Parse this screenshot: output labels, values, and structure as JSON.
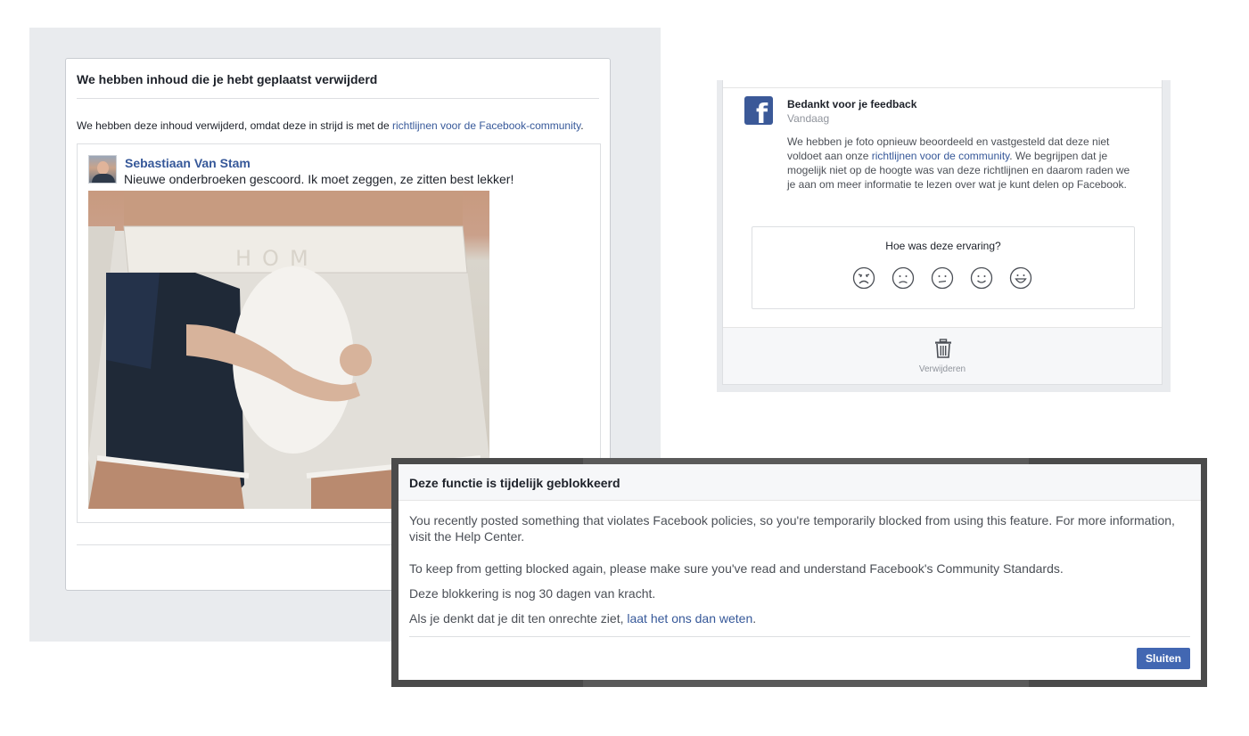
{
  "removed_panel": {
    "title": "We hebben inhoud die je hebt geplaatst verwijderd",
    "description_prefix": "We hebben deze inhoud verwijderd, omdat deze in strijd is met de ",
    "description_link": "richtlijnen voor de Facebook-community",
    "description_suffix": ".",
    "post": {
      "author": "Sebastiaan Van Stam",
      "text": "Nieuwe onderbroeken gescoord. Ik moet zeggen, ze zitten best lekker!",
      "image_brand_text": "HOM"
    }
  },
  "feedback_panel": {
    "title": "Bedankt voor je feedback",
    "time": "Vandaag",
    "body_prefix": "We hebben je foto opnieuw beoordeeld en vastgesteld dat deze niet voldoet aan onze ",
    "body_link": "richtlijnen voor de community",
    "body_suffix": ". We begrijpen dat je mogelijk niet op de hoogte was van deze richtlijnen en daarom raden we je aan om meer informatie te lezen over wat je kunt delen op Facebook.",
    "experience_question": "Hoe was deze ervaring?",
    "rating_options": [
      "very-sad-face-icon",
      "sad-face-icon",
      "neutral-face-icon",
      "smile-face-icon",
      "grin-face-icon"
    ],
    "delete_label": "Verwijderen",
    "logo_letter": "f"
  },
  "blocked_dialog": {
    "title": "Deze functie is tijdelijk geblokkeerd",
    "paragraph1": "You recently posted something that violates Facebook policies, so you're temporarily blocked from using this feature. For more information, visit the Help Center.",
    "paragraph2": "To keep from getting blocked again, please make sure you've read and understand Facebook's Community Standards.",
    "paragraph3": "Deze blokkering is nog 30 dagen van kracht.",
    "paragraph4_prefix": "Als je denkt dat je dit ten onrechte ziet, ",
    "paragraph4_link": "laat het ons dan weten",
    "paragraph4_suffix": ".",
    "close_label": "Sluiten"
  },
  "colors": {
    "facebook_blue": "#3b5998",
    "link_blue": "#365899",
    "button_blue": "#4267b2",
    "background_gray": "#e9ebee"
  }
}
